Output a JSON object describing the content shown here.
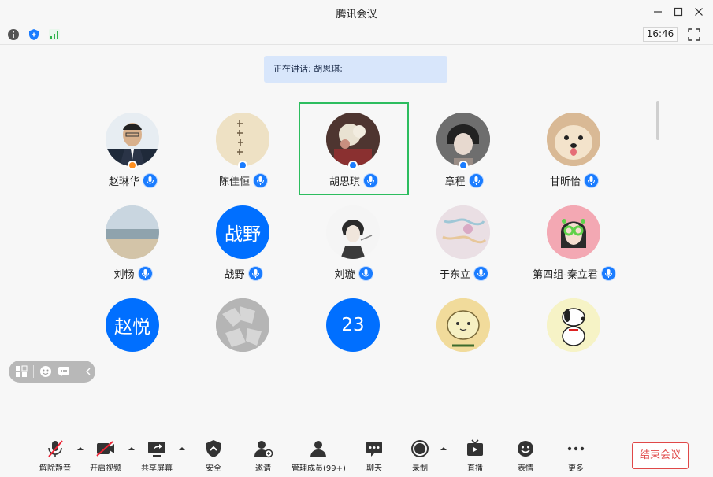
{
  "window": {
    "title": "腾讯会议"
  },
  "status": {
    "clock": "16:46"
  },
  "speaking": {
    "label": "正在讲话: 胡思琪;"
  },
  "participants": [
    {
      "name": "赵琳华",
      "avatar_type": "photo-man-suit",
      "badge": "host"
    },
    {
      "name": "陈佳恒",
      "avatar_type": "photo-calligraphy",
      "badge": "member"
    },
    {
      "name": "胡思琪",
      "avatar_type": "photo-flowers",
      "badge": "member",
      "speaking": true
    },
    {
      "name": "章程",
      "avatar_type": "photo-anime",
      "badge": "member"
    },
    {
      "name": "甘昕怡",
      "avatar_type": "photo-dog"
    },
    {
      "name": "刘畅",
      "avatar_type": "photo-beach"
    },
    {
      "name": "战野",
      "avatar_text": "战野"
    },
    {
      "name": "刘璇",
      "avatar_type": "photo-sketch"
    },
    {
      "name": "于东立",
      "avatar_type": "photo-pastel"
    },
    {
      "name": "第四组-秦立君",
      "avatar_type": "photo-girl-green"
    },
    {
      "name": "",
      "avatar_text": "赵悦"
    },
    {
      "name": "",
      "avatar_type": "photo-grey"
    },
    {
      "name": "",
      "avatar_text": "23"
    },
    {
      "name": "",
      "avatar_type": "photo-cartoon-egg"
    },
    {
      "name": "",
      "avatar_type": "photo-snoopy"
    }
  ],
  "toolbar": {
    "unmute": "解除静音",
    "video": "开启视频",
    "share": "共享屏幕",
    "security": "安全",
    "invite": "邀请",
    "members": "管理成员(99+)",
    "chat": "聊天",
    "record": "录制",
    "live": "直播",
    "emoji": "表情",
    "more": "更多",
    "end": "结束会议"
  },
  "colors": {
    "accent": "#006fff",
    "active_border": "#2dbd5f",
    "end": "#e04848"
  }
}
